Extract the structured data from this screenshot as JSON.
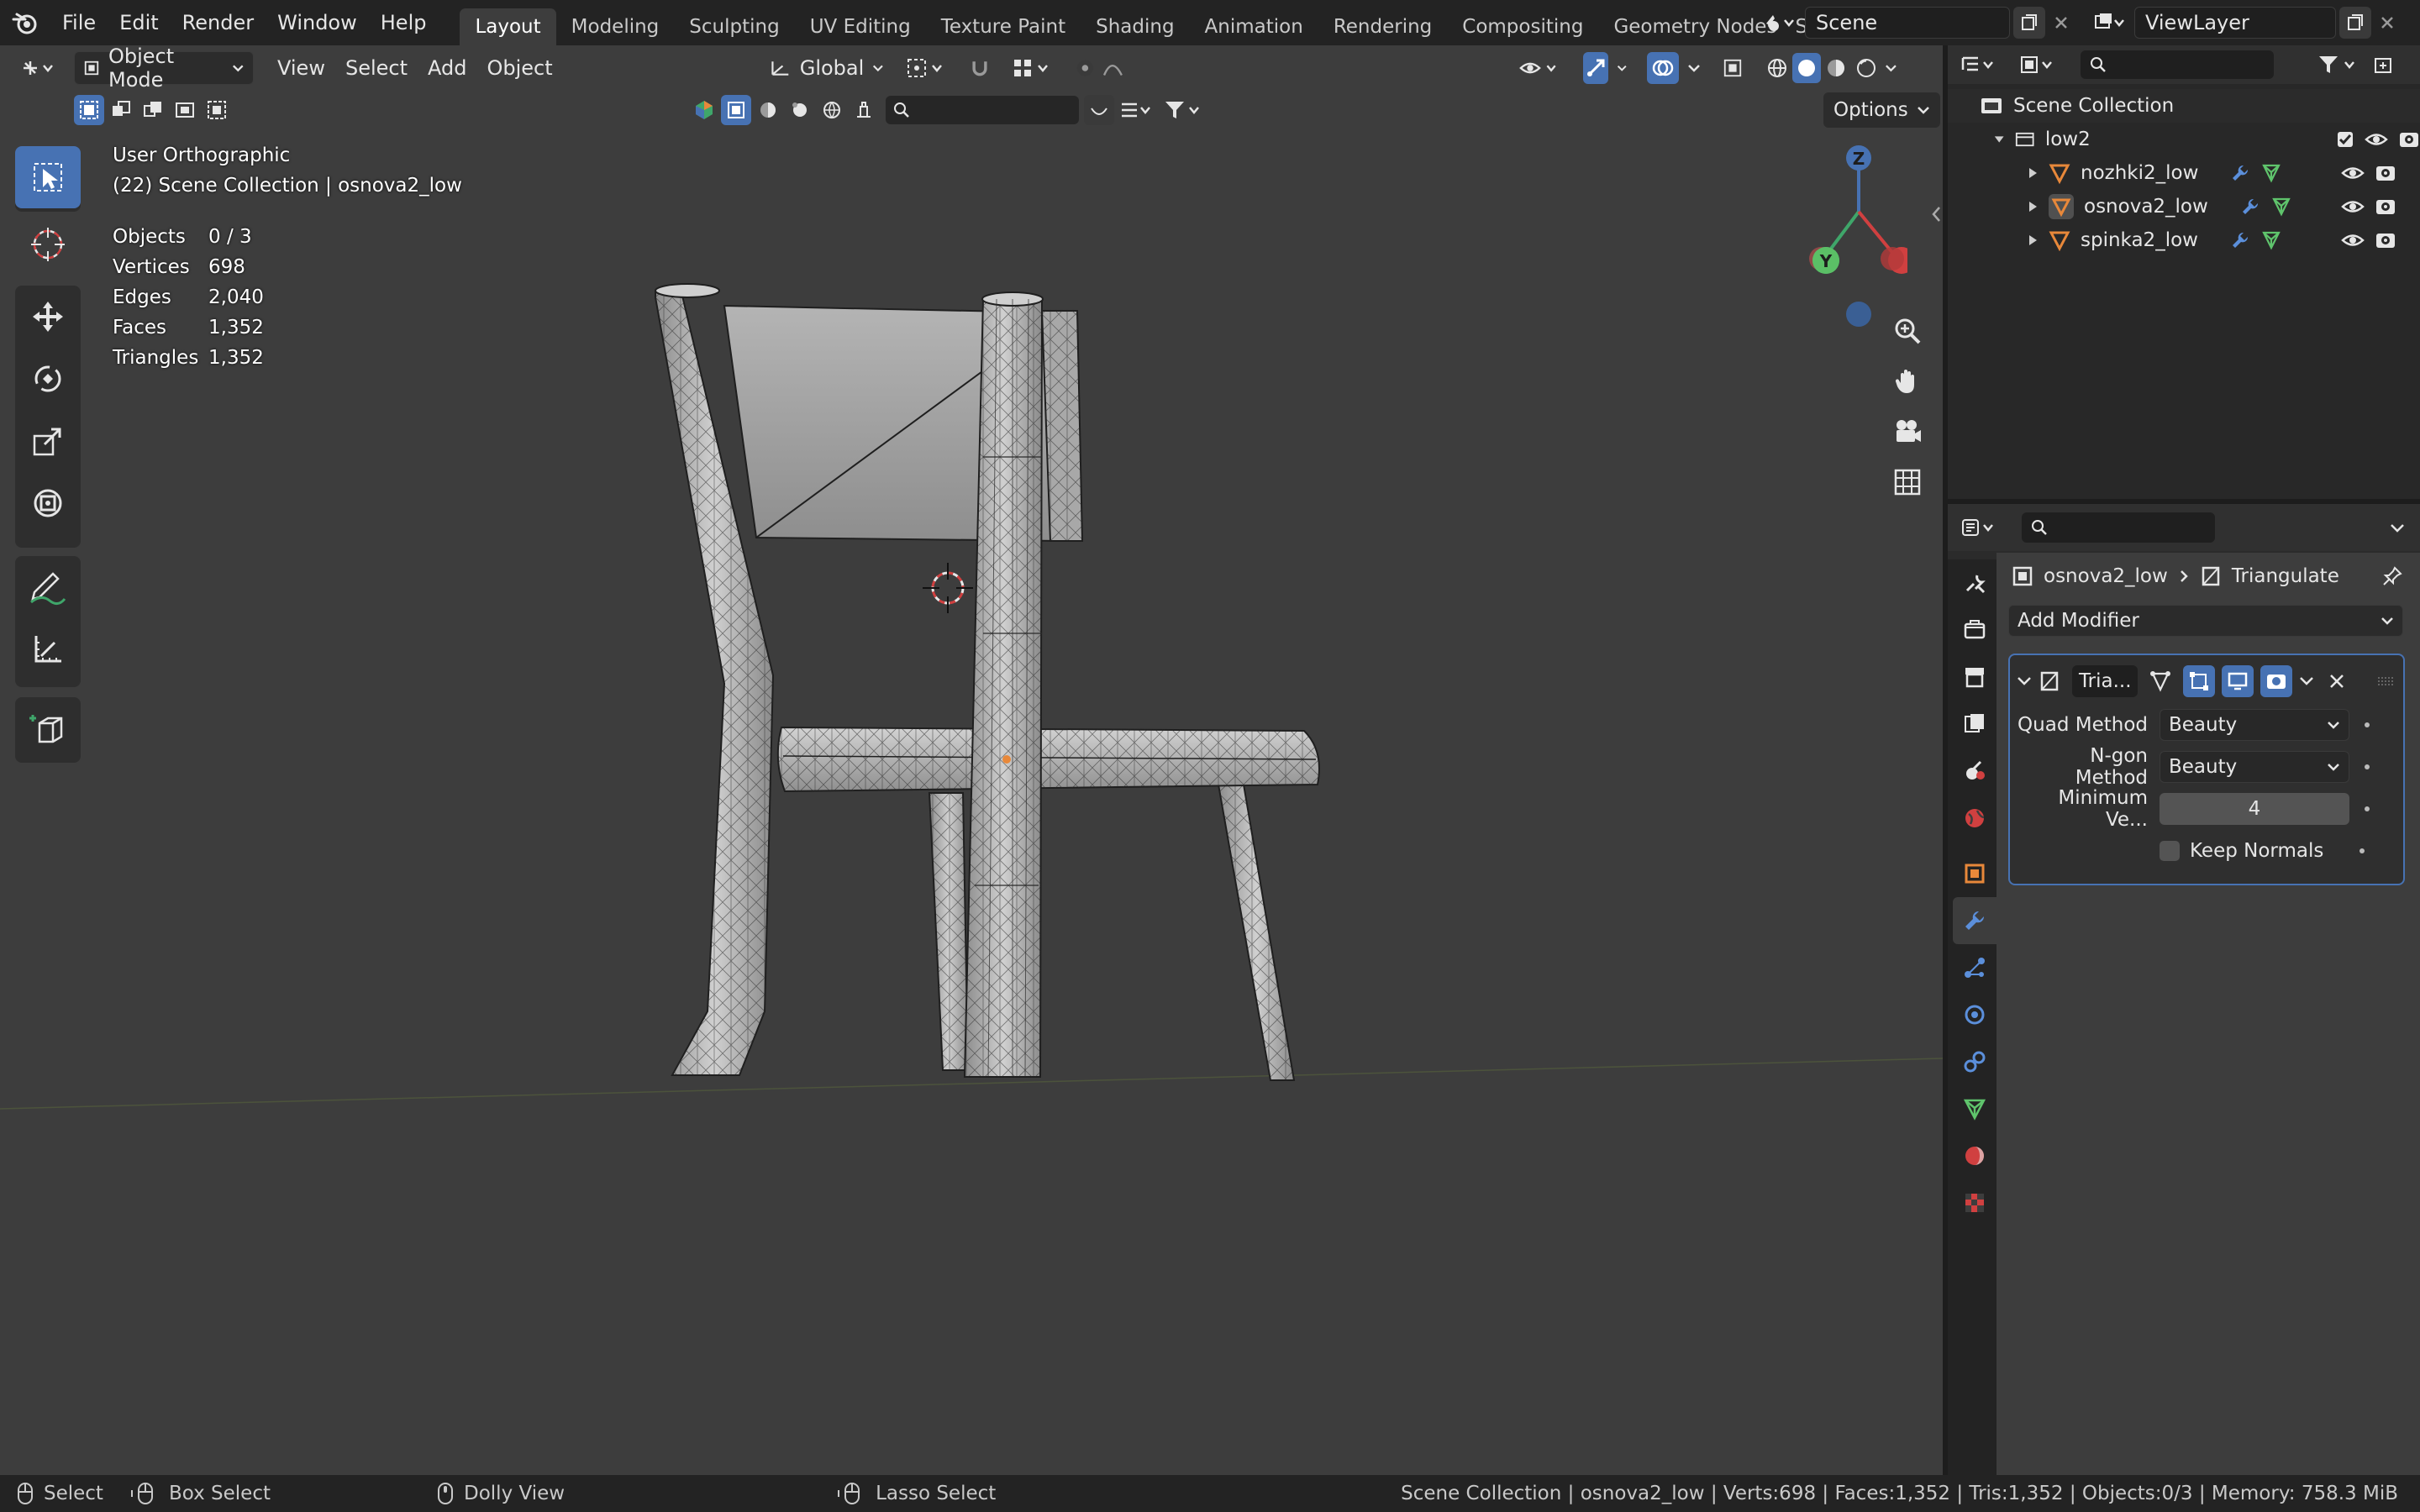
{
  "menubar": {
    "items": [
      "File",
      "Edit",
      "Render",
      "Window",
      "Help"
    ]
  },
  "workspaces": {
    "tabs": [
      "Layout",
      "Modeling",
      "Sculpting",
      "UV Editing",
      "Texture Paint",
      "Shading",
      "Animation",
      "Rendering",
      "Compositing",
      "Geometry Nodes",
      "S"
    ],
    "active": "Layout"
  },
  "scene": {
    "label": "Scene"
  },
  "viewlayer": {
    "label": "ViewLayer"
  },
  "viewport_header": {
    "mode": "Object Mode",
    "menus": [
      "View",
      "Select",
      "Add",
      "Object"
    ],
    "transform_orientation": "Global",
    "options_label": "Options"
  },
  "viewport_overlay": {
    "view_name": "User Orthographic",
    "collection_info": "(22) Scene Collection | osnova2_low",
    "stats": [
      {
        "label": "Objects",
        "value": "0 / 3"
      },
      {
        "label": "Vertices",
        "value": "698"
      },
      {
        "label": "Edges",
        "value": "2,040"
      },
      {
        "label": "Faces",
        "value": "1,352"
      },
      {
        "label": "Triangles",
        "value": "1,352"
      }
    ]
  },
  "gizmo": {
    "z": "Z",
    "y": "Y"
  },
  "outliner": {
    "root": "Scene Collection",
    "collection": "low2",
    "objects": [
      "nozhki2_low",
      "osnova2_low",
      "spinka2_low"
    ]
  },
  "properties": {
    "breadcrumb_object": "osnova2_low",
    "breadcrumb_modifier": "Triangulate",
    "add_modifier": "Add Modifier",
    "modifier": {
      "name": "Tria...",
      "quad_method_label": "Quad Method",
      "quad_method_value": "Beauty",
      "ngon_method_label": "N-gon Method",
      "ngon_method_value": "Beauty",
      "min_vertices_label": "Minimum Ve...",
      "min_vertices_value": "4",
      "keep_normals_label": "Keep Normals",
      "keep_normals_checked": false
    }
  },
  "statusbar": {
    "select": "Select",
    "box_select": "Box Select",
    "dolly_view": "Dolly View",
    "lasso_select": "Lasso Select",
    "info": "Scene Collection | osnova2_low | Verts:698 | Faces:1,352 | Tris:1,352 | Objects:0/3 | Memory: 758.3 MiB"
  },
  "colors": {
    "accent": "#4772b3",
    "viewport_bg": "#3d3d3d",
    "object_orange": "#e8883a",
    "modifier_blue": "#5b8fdb",
    "mesh_green": "#5fc46c"
  }
}
